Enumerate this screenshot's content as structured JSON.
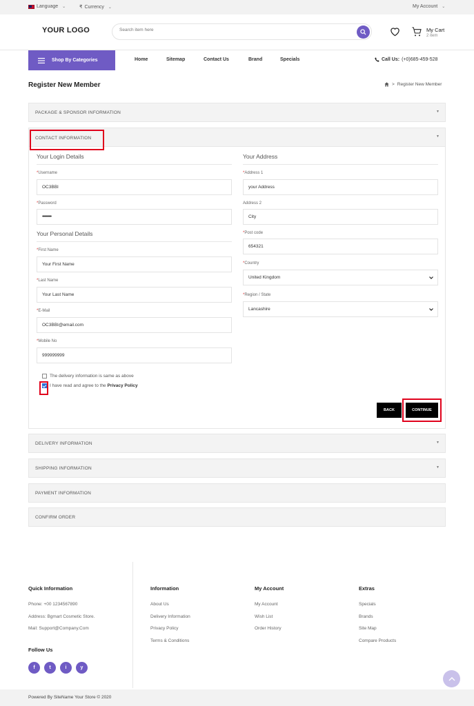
{
  "topbar": {
    "language": "Language",
    "currency_symbol": "₹",
    "currency": "Currency",
    "account": "My Account"
  },
  "header": {
    "logo": "YOUR LOGO",
    "search_placeholder": "Search item here",
    "cart_label": "My Cart",
    "cart_count": "2 item"
  },
  "nav": {
    "categories": "Shop By Categories",
    "links": [
      "Home",
      "Sitemap",
      "Contact Us",
      "Brand",
      "Specials"
    ],
    "call_label": "Call Us:",
    "call_number": "(+0)685-459-528"
  },
  "page": {
    "title": "Register New Member",
    "breadcrumb_sep": ">",
    "breadcrumb_current": "Register New Member"
  },
  "panels": {
    "package": "PACKAGE & SPONSOR INFORMATION",
    "contact": "CONTACT INFORMATION",
    "delivery": "DELIVERY INFORMATION",
    "shipping": "SHIPPING INFORMATION",
    "payment": "PAYMENT INFORMATION",
    "confirm": "CONFIRM ORDER"
  },
  "form": {
    "login_heading": "Your Login Details",
    "username_label": "Username",
    "username": "OC3BBI",
    "password_label": "Password",
    "password": "•••••••••",
    "personal_heading": "Your Personal Details",
    "firstname_label": "First Name",
    "firstname": "Your First Name",
    "lastname_label": "Last Name",
    "lastname": "Your Last Name",
    "email_label": "E-Mail",
    "email": "OC3BBI@email.com",
    "mobile_label": "Mobile No",
    "mobile": "999999999",
    "address_heading": "Your Address",
    "address1_label": "Address 1",
    "address1": "your Address",
    "address2_label": "Address 2",
    "address2": "City",
    "postcode_label": "Post code",
    "postcode": "654321",
    "country_label": "Country",
    "country": "United Kingdom",
    "region_label": "Region / State",
    "region": "Lancashire",
    "required_mark": "*",
    "delivery_same": "The delivery information is same as above",
    "agree_prefix": "I have read and agree to the",
    "agree_link": "Privacy Policy",
    "delivery_same_checked": false,
    "agree_checked": true,
    "back_button": "BACK",
    "continue_button": "CONTINUE"
  },
  "footer": {
    "quick": {
      "heading": "Quick Information",
      "phone": "Phone: +00 1234567890",
      "address": "Address: Bgmart Cosmetic Store.",
      "mail": "Mail: Support@Company.Com"
    },
    "follow": "Follow Us",
    "social": [
      "f",
      "t",
      "i",
      "y"
    ],
    "information": {
      "heading": "Information",
      "items": [
        "About Us",
        "Delivery Information",
        "Privacy Policy",
        "Terms & Conditions"
      ]
    },
    "account": {
      "heading": "My Account",
      "items": [
        "My Account",
        "Wish List",
        "Order History"
      ]
    },
    "extras": {
      "heading": "Extras",
      "items": [
        "Specials",
        "Brands",
        "Site Map",
        "Compare Products"
      ]
    },
    "copyright": "Powered By SiteName Your Store © 2020"
  },
  "colors": {
    "accent": "#6f5bc4",
    "highlight": "#e0001b",
    "button": "#000000"
  }
}
